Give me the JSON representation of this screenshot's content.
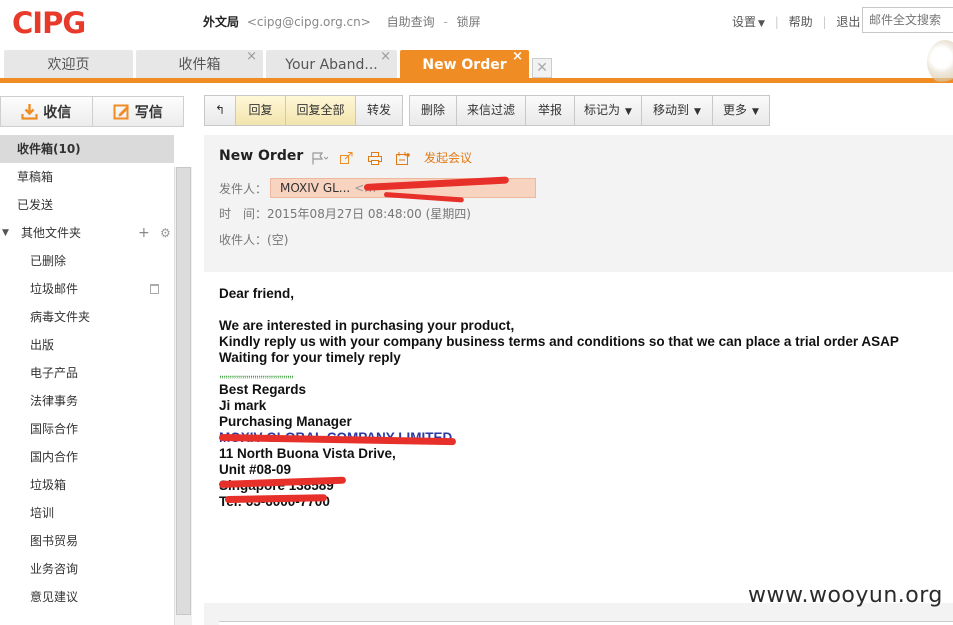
{
  "brand": {
    "logo_text": "CIPG",
    "accent": "#f08c24",
    "logo_red": "#e83a2b"
  },
  "account": {
    "name": "外文局",
    "email": "<cipg@cipg.org.cn>",
    "self_service": "自助查询",
    "dash": "-",
    "lock": "锁屏"
  },
  "toplinks": {
    "settings": "设置",
    "help": "帮助",
    "logout": "退出",
    "sep": "|"
  },
  "search": {
    "placeholder": "邮件全文搜索"
  },
  "tabs": [
    {
      "label": "欢迎页"
    },
    {
      "label": "收件箱",
      "close": "×"
    },
    {
      "label": "Your Aband...",
      "close": "×"
    },
    {
      "label": "New Order",
      "close": "×"
    }
  ],
  "sidebar": {
    "receive": "收信",
    "compose": "写信",
    "folders": [
      {
        "label": "收件箱(10)"
      },
      {
        "label": "草稿箱"
      },
      {
        "label": "已发送"
      }
    ],
    "other_group": {
      "label": "其他文件夹",
      "plus": "+",
      "gear": "⚙",
      "tri": "▼"
    },
    "subfolders": [
      {
        "label": "已删除"
      },
      {
        "label": "垃圾邮件"
      },
      {
        "label": "病毒文件夹"
      },
      {
        "label": "出版"
      },
      {
        "label": "电子产品"
      },
      {
        "label": "法律事务"
      },
      {
        "label": "国际合作"
      },
      {
        "label": "国内合作"
      },
      {
        "label": "垃圾箱"
      },
      {
        "label": "培训"
      },
      {
        "label": "图书贸易"
      },
      {
        "label": "业务咨询"
      },
      {
        "label": "意见建议"
      }
    ]
  },
  "toolbar": {
    "back": "↰",
    "reply": "回复",
    "reply_all": "回复全部",
    "forward": "转发",
    "delete": "删除",
    "filter": "来信过滤",
    "report": "举报",
    "mark_as": "标记为",
    "move_to": "移动到",
    "more": "更多",
    "caret": "▼"
  },
  "mail": {
    "subject": "New Order",
    "meeting": "发起会议",
    "from_label": "发件人：",
    "sender_name": "MOXIV GL...",
    "sender_addr": "<m",
    "time_label": "时　间：",
    "time_value": "2015年08月27日 08:48:00 (星期四)",
    "to_label": "收件人：",
    "to_value": "(空)",
    "body": {
      "greeting": "Dear friend,",
      "p1": "We are interested in purchasing your product,",
      "p2": "Kindly reply us with your company business terms and conditions so that we can place a trial order ASAP",
      "p3": "Waiting for your timely reply",
      "commas": ",,,,,,,,,,,,,,,,,,,,,,,,,,,,,,,,,,,,",
      "regards": "Best Regards",
      "name": "Ji mark",
      "title": "Purchasing Manager",
      "company": "MOXIV GLOBAL COMPANY LIMITED",
      "addr1": "11 North Buona Vista Drive,",
      "addr2": "Unit #08-09",
      "addr3": "Singapore 138589",
      "tel": "Tel: 65-6000-7700"
    }
  },
  "watermark": "www.wooyun.org"
}
